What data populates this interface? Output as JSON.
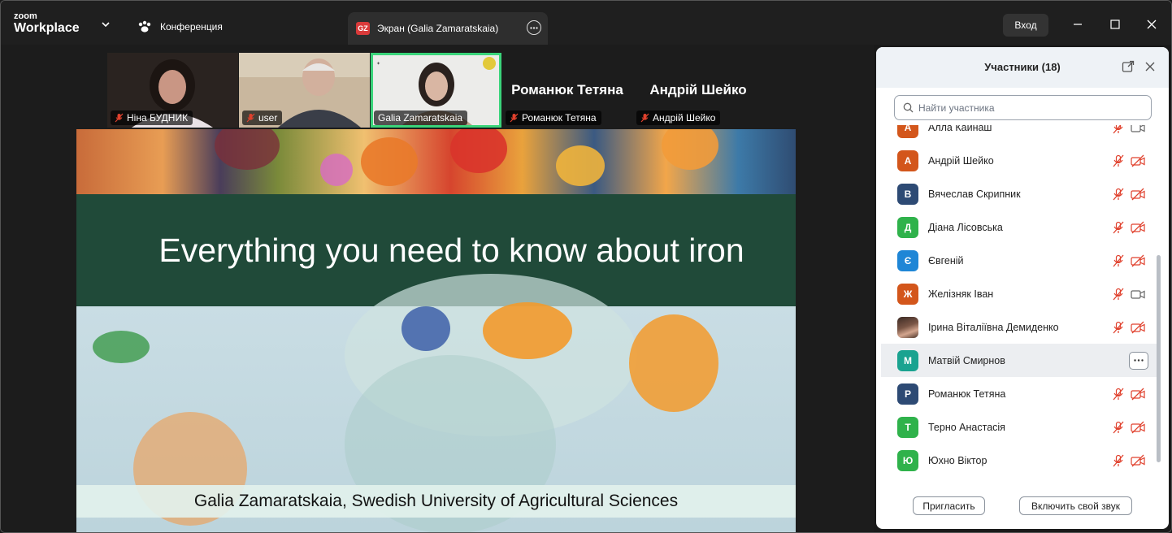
{
  "app": {
    "logo_small": "zoom",
    "logo_big": "Workplace"
  },
  "tabs": {
    "conference": "Конференция",
    "screen": "Экран (Galia Zamaratskaia)",
    "screen_badge": "GZ"
  },
  "header": {
    "login": "Вход"
  },
  "thumbnails": [
    {
      "name": "Ніна БУДНИК",
      "muted": true,
      "type": "video"
    },
    {
      "name": "user",
      "muted": true,
      "type": "video"
    },
    {
      "name": "Galia Zamaratskaia",
      "muted": false,
      "type": "video",
      "active_speaker": true
    },
    {
      "name": "Романюк Тетяна",
      "display_name": "Романюк Тетяна",
      "muted": true,
      "type": "name"
    },
    {
      "name": "Андрій Шейко",
      "display_name": "Андрій Шейко",
      "muted": true,
      "type": "name"
    }
  ],
  "slide": {
    "title": "Everything you need to know about iron",
    "caption": "Galia Zamaratskaia, Swedish University of Agricultural Sciences"
  },
  "participants_panel": {
    "title": "Участники (18)",
    "search_placeholder": "Найти участника",
    "participants": [
      {
        "initial": "А",
        "name": "Алла Кайнаш",
        "color": "#d3561b",
        "mic_off": true,
        "video_off": false
      },
      {
        "initial": "А",
        "name": "Андрій Шейко",
        "color": "#d3561b",
        "mic_off": true,
        "video_off": true
      },
      {
        "initial": "В",
        "name": "Вячеслав Скрипник",
        "color": "#2d4a74",
        "mic_off": true,
        "video_off": true
      },
      {
        "initial": "Д",
        "name": "Діана Лісовська",
        "color": "#2fb24b",
        "mic_off": true,
        "video_off": true
      },
      {
        "initial": "Є",
        "name": "Євгеній",
        "color": "#1f86d6",
        "mic_off": true,
        "video_off": true
      },
      {
        "initial": "Ж",
        "name": "Желізняк Іван",
        "color": "#d3561b",
        "mic_off": true,
        "video_off": false
      },
      {
        "initial": "",
        "name": "Ірина Віталіївна Демиденко",
        "color": "#6b4a3a",
        "mic_off": true,
        "video_off": true,
        "photo": true
      },
      {
        "initial": "М",
        "name": "Матвій Смирнов",
        "color": "#1aa390",
        "mic_off": false,
        "video_off": false,
        "highlighted": true
      },
      {
        "initial": "Р",
        "name": "Романюк Тетяна",
        "color": "#2d4a74",
        "mic_off": true,
        "video_off": true
      },
      {
        "initial": "Т",
        "name": "Терно Анастасія",
        "color": "#2fb24b",
        "mic_off": true,
        "video_off": true
      },
      {
        "initial": "Ю",
        "name": "Юхно Віктор",
        "color": "#2fb24b",
        "mic_off": true,
        "video_off": true
      }
    ],
    "invite": "Пригласить",
    "unmute": "Включить свой звук"
  }
}
